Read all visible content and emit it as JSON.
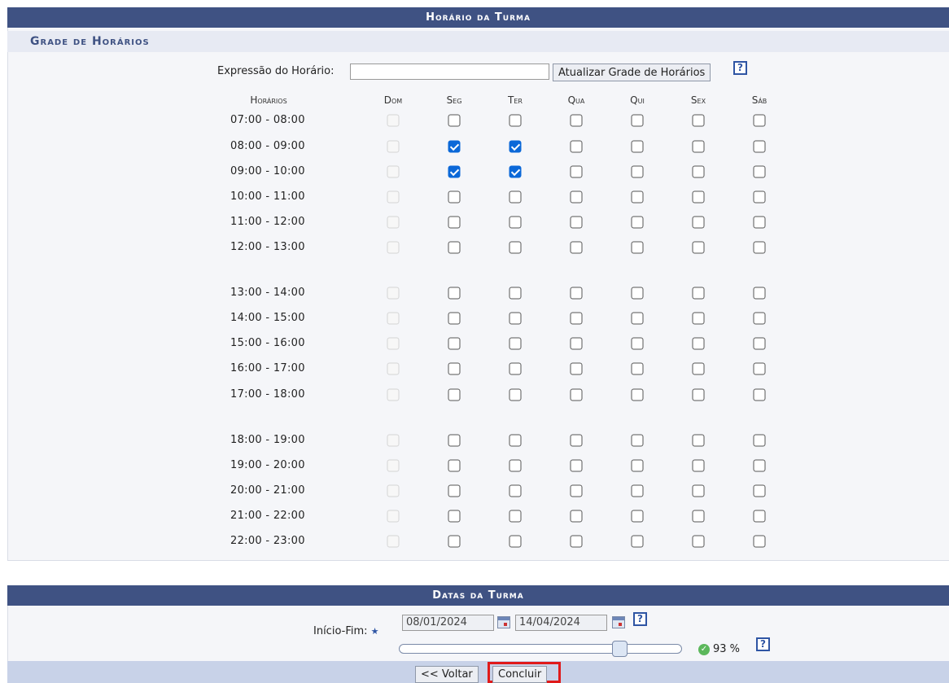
{
  "section1": {
    "title": "Horário da Turma",
    "subtitle": "Grade de Horários"
  },
  "expression": {
    "label": "Expressão do Horário:",
    "value": "",
    "update_button": "Atualizar Grade de Horários",
    "help": "?"
  },
  "grid": {
    "time_header": "Horários",
    "days": [
      "Dom",
      "Seg",
      "Ter",
      "Qua",
      "Qui",
      "Sex",
      "Sáb"
    ],
    "rows": [
      {
        "time": "07:00 - 08:00",
        "checked": [
          false,
          false,
          false,
          false,
          false,
          false,
          false
        ]
      },
      {
        "time": "08:00 - 09:00",
        "checked": [
          false,
          true,
          true,
          false,
          false,
          false,
          false
        ]
      },
      {
        "time": "09:00 - 10:00",
        "checked": [
          false,
          true,
          true,
          false,
          false,
          false,
          false
        ]
      },
      {
        "time": "10:00 - 11:00",
        "checked": [
          false,
          false,
          false,
          false,
          false,
          false,
          false
        ]
      },
      {
        "time": "11:00 - 12:00",
        "checked": [
          false,
          false,
          false,
          false,
          false,
          false,
          false
        ]
      },
      {
        "time": "12:00 - 13:00",
        "checked": [
          false,
          false,
          false,
          false,
          false,
          false,
          false
        ]
      },
      {
        "time": "13:00 - 14:00",
        "checked": [
          false,
          false,
          false,
          false,
          false,
          false,
          false
        ]
      },
      {
        "time": "14:00 - 15:00",
        "checked": [
          false,
          false,
          false,
          false,
          false,
          false,
          false
        ]
      },
      {
        "time": "15:00 - 16:00",
        "checked": [
          false,
          false,
          false,
          false,
          false,
          false,
          false
        ]
      },
      {
        "time": "16:00 - 17:00",
        "checked": [
          false,
          false,
          false,
          false,
          false,
          false,
          false
        ]
      },
      {
        "time": "17:00 - 18:00",
        "checked": [
          false,
          false,
          false,
          false,
          false,
          false,
          false
        ]
      },
      {
        "time": "18:00 - 19:00",
        "checked": [
          false,
          false,
          false,
          false,
          false,
          false,
          false
        ]
      },
      {
        "time": "19:00 - 20:00",
        "checked": [
          false,
          false,
          false,
          false,
          false,
          false,
          false
        ]
      },
      {
        "time": "20:00 - 21:00",
        "checked": [
          false,
          false,
          false,
          false,
          false,
          false,
          false
        ]
      },
      {
        "time": "21:00 - 22:00",
        "checked": [
          false,
          false,
          false,
          false,
          false,
          false,
          false
        ]
      },
      {
        "time": "22:00 - 23:00",
        "checked": [
          false,
          false,
          false,
          false,
          false,
          false,
          false
        ]
      }
    ],
    "disabled_days": [
      "Dom"
    ]
  },
  "section2": {
    "title": "Datas da Turma",
    "range_label": "Início-Fim:",
    "required_mark": "★",
    "start_date": "08/01/2024",
    "end_date": "14/04/2024",
    "help": "?",
    "progress_percent": 93,
    "progress_text": "93 %",
    "progress_icon": "check-circle-icon",
    "progress_help": "?"
  },
  "footer": {
    "back_button": "<< Voltar",
    "finish_button": "Concluir",
    "highlight_color": "#e01a1a"
  }
}
